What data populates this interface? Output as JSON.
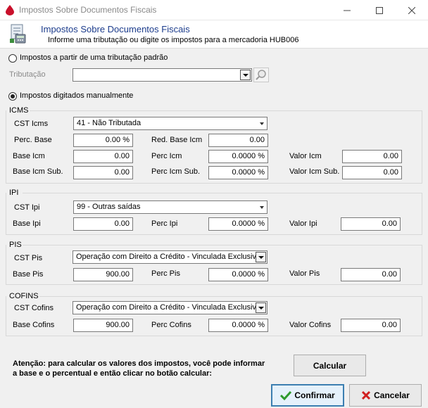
{
  "window": {
    "title": "Impostos Sobre Documentos Fiscais"
  },
  "header": {
    "title": "Impostos Sobre Documentos Fiscais",
    "subtitle": "Informe uma tributação ou digite os impostos para a mercadoria HUB006"
  },
  "padrao": {
    "radio_label": "Impostos a partir de uma tributação padrão",
    "tributacao_label": "Tributação",
    "tributacao_value": ""
  },
  "manual": {
    "radio_label": "Impostos digitados manualmente"
  },
  "icms": {
    "group_label": "ICMS",
    "cst_label": "CST Icms",
    "cst_value": "41 - Não Tributada",
    "perc_base_label": "Perc. Base",
    "perc_base_value": "0.00 %",
    "red_base_label": "Red. Base Icm",
    "red_base_value": "0.00",
    "base_label": "Base Icm",
    "base_value": "0.00",
    "perc_label": "Perc Icm",
    "perc_value": "0.0000 %",
    "valor_label": "Valor Icm",
    "valor_value": "0.00",
    "base_sub_label": "Base Icm Sub.",
    "base_sub_value": "0.00",
    "perc_sub_label": "Perc Icm Sub.",
    "perc_sub_value": "0.0000 %",
    "valor_sub_label": "Valor Icm Sub.",
    "valor_sub_value": "0.00"
  },
  "ipi": {
    "group_label": "IPI",
    "cst_label": "CST Ipi",
    "cst_value": "99 - Outras saídas",
    "base_label": "Base Ipi",
    "base_value": "0.00",
    "perc_label": "Perc Ipi",
    "perc_value": "0.0000 %",
    "valor_label": "Valor Ipi",
    "valor_value": "0.00"
  },
  "pis": {
    "group_label": "PIS",
    "cst_label": "CST Pis",
    "cst_value": "Operação com Direito a Crédito - Vinculada Exclusivar",
    "base_label": "Base Pis",
    "base_value": "900.00",
    "perc_label": "Perc Pis",
    "perc_value": "0.0000 %",
    "valor_label": "Valor Pis",
    "valor_value": "0.00"
  },
  "cofins": {
    "group_label": "COFINS",
    "cst_label": "CST Cofins",
    "cst_value": "Operação com Direito a Crédito - Vinculada Exclusivar",
    "base_label": "Base Cofins",
    "base_value": "900.00",
    "perc_label": "Perc Cofins",
    "perc_value": "0.0000 %",
    "valor_label": "Valor Cofins",
    "valor_value": "0.00"
  },
  "footer": {
    "note_line1": "Atenção: para calcular os valores dos impostos, você pode informar",
    "note_line2": "a base e o percentual e então clicar no botão calcular:",
    "calcular_label": "Calcular",
    "confirmar_label": "Confirmar",
    "cancelar_label": "Cancelar"
  },
  "colors": {
    "accent": "#1c3c8c",
    "confirm": "#2e9a2e",
    "cancel": "#d02020",
    "focus": "#3c7fb1"
  },
  "icons": [
    "app-icon",
    "document-icon",
    "search-icon",
    "check-icon",
    "cancel-x-icon"
  ]
}
